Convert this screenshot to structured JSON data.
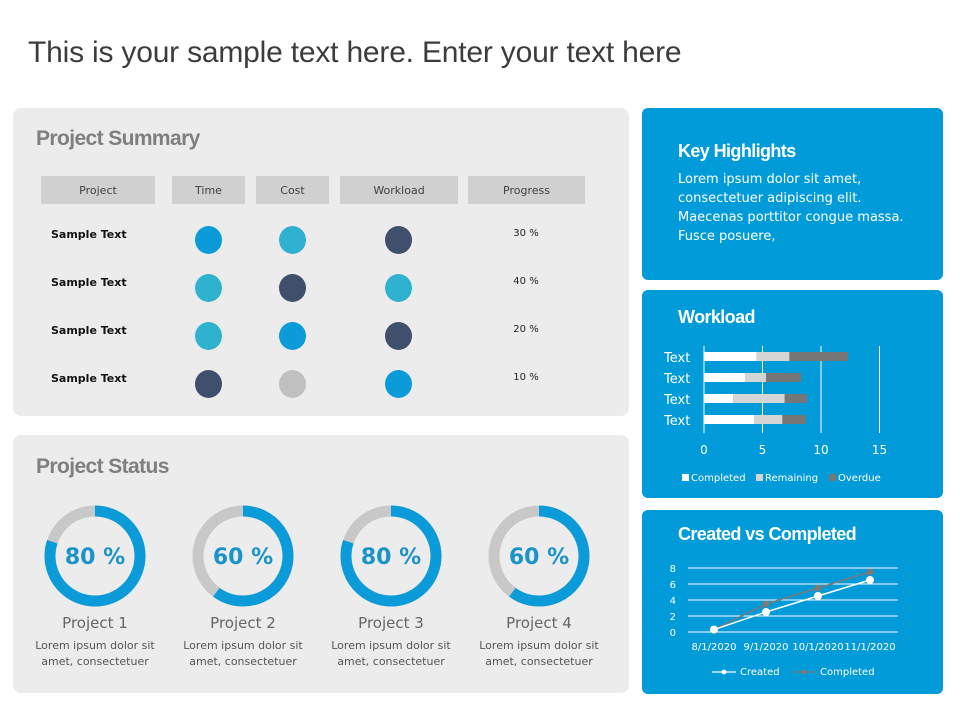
{
  "page": {
    "title": "This is your sample text here. Enter your text here"
  },
  "colors": {
    "accent_blue": "#009bd8",
    "bright_blue": "#0a9bd8",
    "teal": "#2fb2d0",
    "navy": "#404f6b",
    "light_grey": "#c0c0c0",
    "panel_grey": "#ececec"
  },
  "summary": {
    "title": "Project Summary",
    "headers": [
      "Project",
      "Time",
      "Cost",
      "Workload",
      "Progress"
    ],
    "rows": [
      {
        "name": "Sample Text",
        "time": "bright_blue",
        "cost": "teal",
        "workload": "navy",
        "progress": "30 %"
      },
      {
        "name": "Sample Text",
        "time": "teal",
        "cost": "navy",
        "workload": "teal",
        "progress": "40 %"
      },
      {
        "name": "Sample Text",
        "time": "teal",
        "cost": "bright_blue",
        "workload": "navy",
        "progress": "20 %"
      },
      {
        "name": "Sample Text",
        "time": "navy",
        "cost": "light_grey",
        "workload": "bright_blue",
        "progress": "10 %"
      }
    ]
  },
  "status": {
    "title": "Project Status",
    "projects": [
      {
        "label": "80 %",
        "value": 0.8,
        "name": "Project 1",
        "desc1": "Lorem  ipsum dolor sit",
        "desc2": "amet, consectetuer"
      },
      {
        "label": "60 %",
        "value": 0.6,
        "name": "Project 2",
        "desc1": "Lorem  ipsum dolor sit",
        "desc2": "amet, consectetuer"
      },
      {
        "label": "80 %",
        "value": 0.8,
        "name": "Project 3",
        "desc1": "Lorem  ipsum dolor sit",
        "desc2": "amet, consectetuer"
      },
      {
        "label": "60 %",
        "value": 0.6,
        "name": "Project 4",
        "desc1": "Lorem  ipsum dolor sit",
        "desc2": "amet, consectetuer"
      }
    ]
  },
  "highlights": {
    "title": "Key Highlights",
    "lines": [
      "Lorem ipsum dolor sit amet,",
      "consectetuer adipiscing elit.",
      "Maecenas porttitor congue massa.",
      "Fusce posuere,"
    ]
  },
  "chart_data": [
    {
      "type": "bar",
      "orientation": "horizontal",
      "stacked": true,
      "title": "Workload",
      "categories": [
        "Text",
        "Text",
        "Text",
        "Text"
      ],
      "series": [
        {
          "name": "Completed",
          "color": "#ffffff",
          "values": [
            4.5,
            3.5,
            2.5,
            4.3
          ]
        },
        {
          "name": "Remaining",
          "color": "#d5d5d5",
          "values": [
            2.8,
            1.8,
            4.4,
            2.4
          ]
        },
        {
          "name": "Overdue",
          "color": "#767676",
          "values": [
            5.0,
            3.0,
            1.9,
            2.0
          ]
        }
      ],
      "xlim": [
        0,
        15
      ],
      "xticks": [
        "0",
        "5",
        "10",
        "15"
      ],
      "grid": true,
      "legend": "bottom"
    },
    {
      "type": "line",
      "title": "Created vs Completed",
      "x": [
        "8/1/2020",
        "9/1/2020",
        "10/1/2020",
        "11/1/2020"
      ],
      "series": [
        {
          "name": "Created",
          "color": "#ffffff",
          "values": [
            0.3,
            2.5,
            4.5,
            6.5
          ]
        },
        {
          "name": "Completed",
          "color": "#7a7a7a",
          "values": [
            0.3,
            3.5,
            5.5,
            7.5
          ]
        }
      ],
      "ylim": [
        0,
        8
      ],
      "yticks": [
        "0",
        "2",
        "4",
        "6",
        "8"
      ],
      "grid": true,
      "legend": "bottom"
    }
  ]
}
